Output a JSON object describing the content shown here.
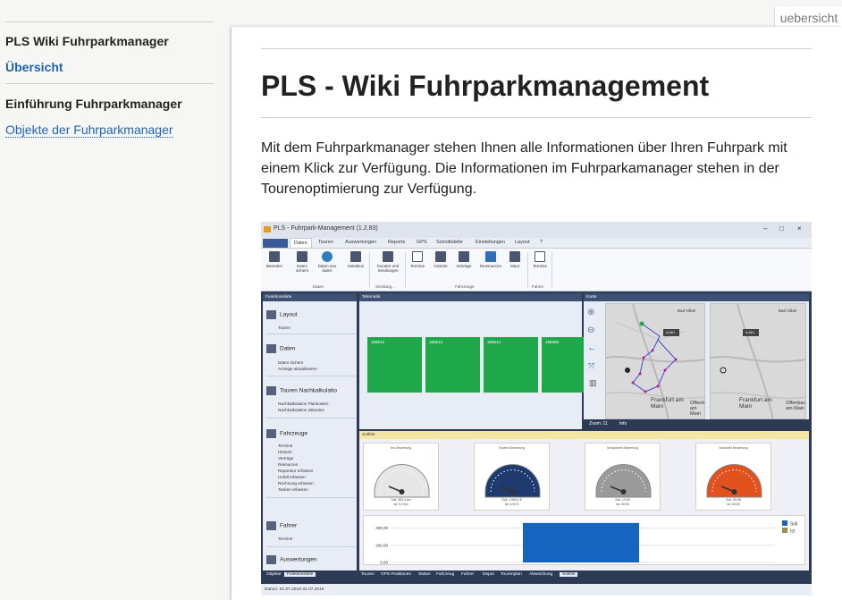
{
  "sidebar": {
    "heading": "PLS Wiki Fuhrparkmanager",
    "overview_link": "Übersicht",
    "section": "Einführung Fuhrparkmanager",
    "objects_link": "Objekte der Fuhrparkmanager"
  },
  "page_tag": "uebersicht",
  "article": {
    "title": "PLS - Wiki Fuhrparkmanagement",
    "intro": "Mit dem Fuhrparkmanager stehen Ihnen alle Informationen über Ihren Fuhrpark mit einem Klick zur Verfügung. Die Informationen im Fuhrparkamanager stehen in der Tourenoptimierung zur Verfügung."
  },
  "app": {
    "window_title": "PLS - Fuhrpark-Management (1.2.83)",
    "window_buttons": [
      "–",
      "□",
      "×"
    ],
    "menu": [
      "Daten",
      "Touren",
      "Auswertungen",
      "Reports",
      "GPS",
      "Schnittstelle",
      "Einstellungen",
      "Layout",
      "?"
    ],
    "ribbon": {
      "buttons": [
        "Beenden",
        "Daten sichern",
        "Daten neu laden",
        "Selektion",
        "Kunden und Sendungen",
        "Termine",
        "Historie",
        "Verträge",
        "Ressourcen",
        "Maut",
        "Termine"
      ],
      "groups": [
        "Daten",
        "Sendung...",
        "Fahrzeuge",
        "Fahrer"
      ],
      "calendar_day": "31"
    },
    "funktionsliste": {
      "title": "Funktionsliste",
      "sections": [
        {
          "label": "Layout",
          "items": [
            "Touren"
          ]
        },
        {
          "label": "Daten",
          "items": [
            "Daten sichern",
            "Anzeige aktualisieren"
          ]
        },
        {
          "label": "Touren Nachkalkulatio",
          "items": [
            "Nachkalkulation Plankosten",
            "Nachkalkulation Istkosten"
          ]
        },
        {
          "label": "Fahrzeuge",
          "items": [
            "Termine",
            "Historie",
            "Verträge",
            "Resourcen",
            "Reparatur erfassen",
            "Unfall erfassen",
            "Rechnung erfassen",
            "Tanken erfassen"
          ]
        },
        {
          "label": "Fahrer",
          "items": [
            "Termine"
          ]
        },
        {
          "label": "Auswertungen",
          "items": []
        }
      ],
      "bottom_tabs": [
        "Objekte",
        "Funktionsliste"
      ]
    },
    "telematik": {
      "title": "Telematik",
      "tiles": [
        "183612",
        "183613",
        "183614",
        "196358"
      ]
    },
    "karte": {
      "title": "Karte",
      "zoom_label": "Zoom: 11",
      "info_tab": "Info",
      "places": [
        "Bad Vilbel",
        "A 661",
        "Frankfurt am Main",
        "Offenbach am Main"
      ]
    },
    "sollist": {
      "title": "Soll/Ist",
      "gauges": [
        {
          "title": "Km-Bewertung",
          "soll": "Soll: 963,4 km",
          "ist": "Ist: 0,0 km",
          "color": "#e6e6e6"
        },
        {
          "title": "Kosten-Bewertung",
          "soll": "Soll: 1.506,0 €",
          "ist": "Ist: 4,00 €",
          "color": "#1e3a6e"
        },
        {
          "title": "Gesamtzeit Bewertung",
          "soll": "Soll: 13:29",
          "ist": "Ist: 00:00",
          "color": "#9a9a9a"
        },
        {
          "title": "Standzeit Bewertung",
          "soll": "Soll: 00:08",
          "ist": "Ist: 00:00",
          "color": "#e0511e"
        }
      ],
      "legend": [
        "Soll",
        "Ist"
      ],
      "legend_colors": [
        "#1565c0",
        "#a08a55"
      ]
    },
    "bottom_tabs": [
      "Touren",
      "GPS-Positionen",
      "Status",
      "Fahrzeug",
      "Fahrer",
      "Depot",
      "Tourenplan",
      "Abweichung",
      "Soll/Ist"
    ],
    "status_text": "Datum: 01.07.2019-31.07.2019",
    "chart_data": {
      "type": "bar",
      "categories": [
        ""
      ],
      "series": [
        {
          "name": "Soll",
          "values": [
            460
          ]
        },
        {
          "name": "Ist",
          "values": [
            0
          ]
        }
      ],
      "yticks": [
        "400,00",
        "200,00",
        "0,00"
      ],
      "ylim": [
        0,
        500
      ]
    }
  }
}
